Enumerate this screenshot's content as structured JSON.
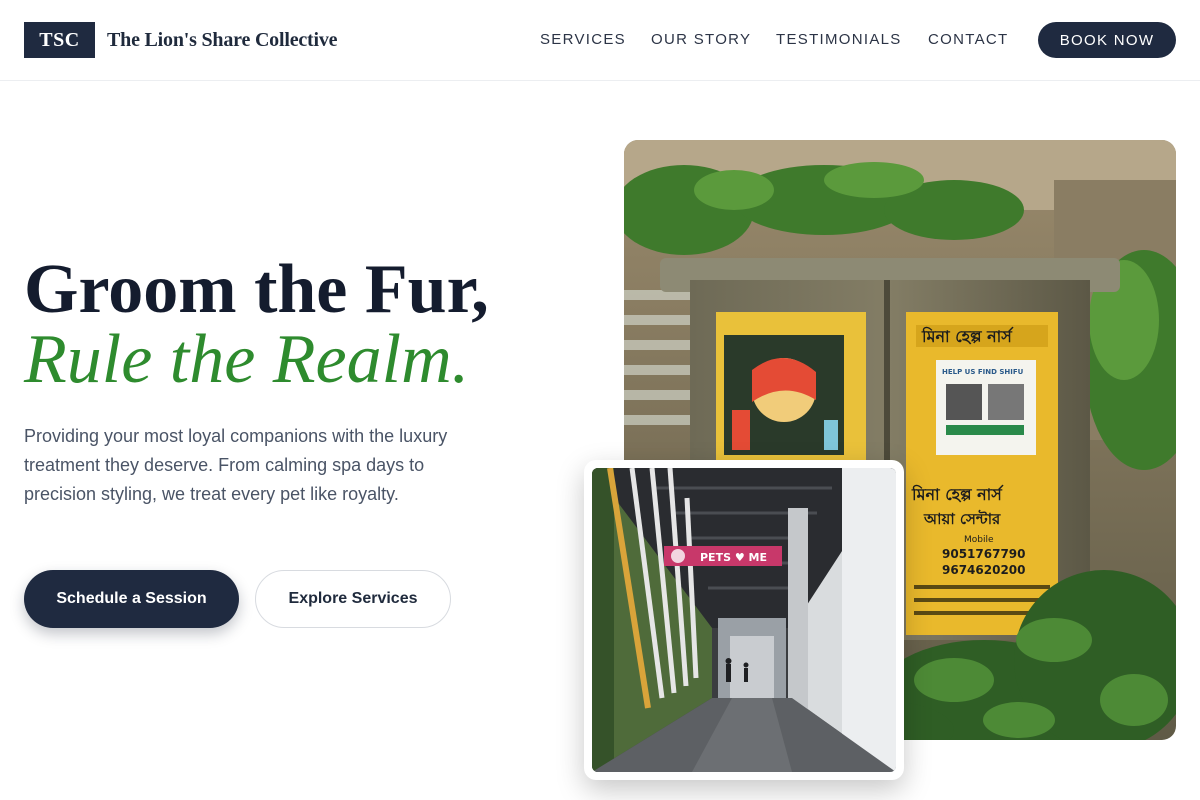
{
  "header": {
    "logo_text": "TSC",
    "brand_name": "The Lion's Share Collective",
    "nav": {
      "services": "SERVICES",
      "our_story": "OUR STORY",
      "testimonials": "TESTIMONIALS",
      "contact": "CONTACT"
    },
    "book_button": "BOOK NOW"
  },
  "hero": {
    "headline_line1": "Groom the Fur,",
    "headline_line2": "Rule the Realm.",
    "description": "Providing your most loyal companions with the luxury treatment they deserve. From calming spa days to precision styling, we treat every pet like royalty.",
    "primary_button": "Schedule a Session",
    "secondary_button": "Explore Services"
  },
  "images": {
    "main_photo": {
      "poster_left_text": "",
      "poster_right_title": "মিনা হেল্প নার্স",
      "poster_right_subtitle": "আয়া সেন্টার",
      "poster_right_phone1": "9051767790",
      "poster_right_phone2": "9674620200",
      "poster_right_mobile_label": "Mobile",
      "missing_cat_label": "HELP US FIND SHIFU"
    },
    "inset_photo": {
      "shop_sign": "PETS ♥ ME"
    }
  },
  "colors": {
    "navy": "#1f2a40",
    "green_accent": "#2e8b2e",
    "body_text": "#4a5466"
  }
}
